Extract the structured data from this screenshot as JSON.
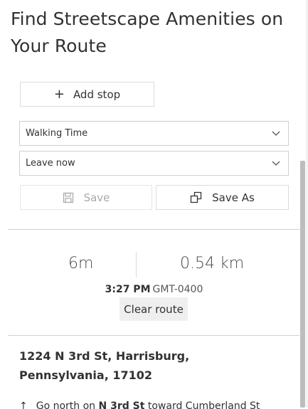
{
  "header": {
    "title": "Find Streetscape Amenities on Your Route"
  },
  "stops": {
    "add_stop_label": "Add stop",
    "add_icon": "plus-icon"
  },
  "travel_mode": {
    "selected": "Walking Time",
    "icon": "chevron-down-icon"
  },
  "departure": {
    "selected": "Leave now",
    "icon": "chevron-down-icon"
  },
  "actions": {
    "save_label": "Save",
    "save_icon": "save-icon",
    "save_as_label": "Save As",
    "save_as_icon": "duplicate-icon"
  },
  "summary": {
    "time": "6m",
    "distance": "0.54 km",
    "arrival_time": "3:27 PM",
    "timezone": "GMT-0400",
    "clear_route_label": "Clear route"
  },
  "directions": {
    "start_address": "1224 N 3rd St, Harrisburg, Pennsylvania, 17102",
    "first_step_prefix": "Go north on",
    "first_step_street": "N 3rd St",
    "first_step_suffix": "toward Cumberland St",
    "first_step_icon": "arrow-up-icon"
  },
  "colors": {
    "text": "#323232",
    "muted": "#a8a8a8",
    "divider": "#cfcfcf",
    "button_bg": "#efefef"
  }
}
